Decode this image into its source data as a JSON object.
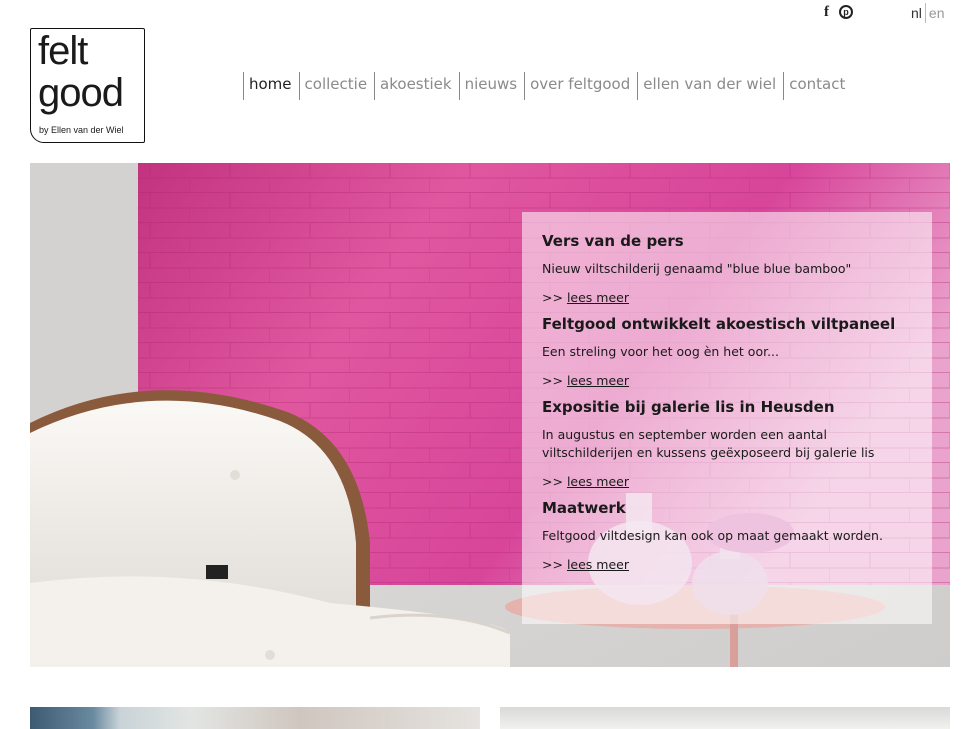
{
  "header": {
    "social": [
      {
        "name": "facebook-icon",
        "glyph": "f"
      },
      {
        "name": "pinterest-icon",
        "glyph": "p"
      }
    ],
    "lang": {
      "nl": "nl",
      "en": "en"
    }
  },
  "logo": {
    "line1": "felt",
    "line2": "good",
    "tagline": "by Ellen van der Wiel"
  },
  "nav": {
    "items": [
      {
        "label": "home",
        "active": true
      },
      {
        "label": "collectie"
      },
      {
        "label": "akoestiek"
      },
      {
        "label": "nieuws"
      },
      {
        "label": "over feltgood"
      },
      {
        "label": "ellen van der wiel"
      },
      {
        "label": "contact"
      }
    ]
  },
  "news": [
    {
      "title": "Vers van de pers",
      "text": "Nieuw viltschilderij genaamd \"blue blue bamboo\"",
      "more_prefix": ">>",
      "more_label": "lees meer"
    },
    {
      "title": "Feltgood ontwikkelt akoestisch viltpaneel",
      "text": "Een streling voor het oog èn het oor...",
      "more_prefix": ">>",
      "more_label": "lees meer"
    },
    {
      "title": "Expositie bij galerie lis in Heusden",
      "text": "In augustus en september worden een aantal viltschilderijen en kussens geëxposeerd bij galerie lis",
      "more_prefix": ">>",
      "more_label": "lees meer"
    },
    {
      "title": "Maatwerk",
      "text": "Feltgood viltdesign kan ook op maat gemaakt worden.",
      "more_prefix": ">>",
      "more_label": "lees meer"
    }
  ],
  "colors": {
    "felt_pink": "#d94c9b",
    "wall": "#dcdad8",
    "chair_white": "#f3f0ec",
    "table": "#e7b6b0"
  }
}
